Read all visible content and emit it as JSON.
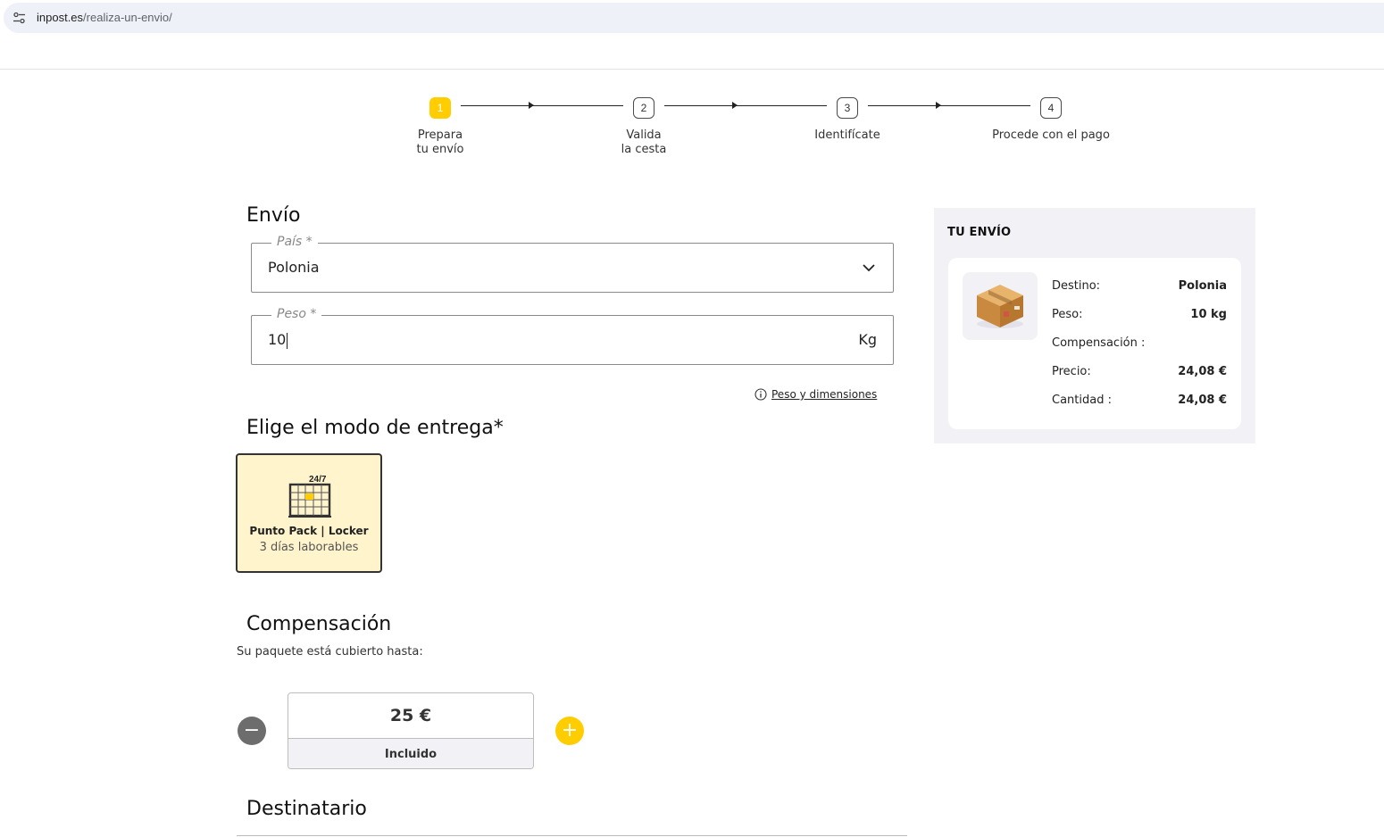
{
  "browser": {
    "url_host": "inpost.es",
    "url_path": "/realiza-un-envio/"
  },
  "stepper": {
    "steps": [
      {
        "number": "1",
        "label_line1": "Prepara",
        "label_line2": "tu envío",
        "state": "active"
      },
      {
        "number": "2",
        "label_line1": "Valida",
        "label_line2": "la cesta",
        "state": "pending"
      },
      {
        "number": "3",
        "label_line1": "Identifícate",
        "label_line2": "",
        "state": "pending"
      },
      {
        "number": "4",
        "label_line1": "Procede con el pago",
        "label_line2": "",
        "state": "pending"
      }
    ]
  },
  "shipment": {
    "heading": "Envío",
    "country_label": "País *",
    "country_value": "Polonia",
    "weight_label": "Peso *",
    "weight_value": "10",
    "weight_unit": "Kg",
    "help_link": "Peso y dimensiones"
  },
  "delivery": {
    "heading": "Elige el modo de entrega*",
    "option_title": "Punto Pack | Locker",
    "option_subtitle": "3 días laborables",
    "icon_badge": "24/7"
  },
  "compensation": {
    "heading": "Compensación",
    "subtitle": "Su paquete está cubierto hasta:",
    "amount": "25 €",
    "note": "Incluido",
    "minus": "−",
    "plus": "+"
  },
  "recipient": {
    "heading": "Destinatario"
  },
  "summary": {
    "title": "TU ENVÍO",
    "rows": [
      {
        "key": "Destino:",
        "value": "Polonia"
      },
      {
        "key": "Peso:",
        "value": "10 kg"
      },
      {
        "key": "Compensación :",
        "value": ""
      },
      {
        "key": "Precio:",
        "value": "24,08 €"
      },
      {
        "key": "Cantidad :",
        "value": "24,08 €"
      }
    ]
  },
  "colors": {
    "brand_yellow": "#ffcd00",
    "card_bg": "#fff4cc",
    "summary_bg": "#f2f1f6"
  }
}
